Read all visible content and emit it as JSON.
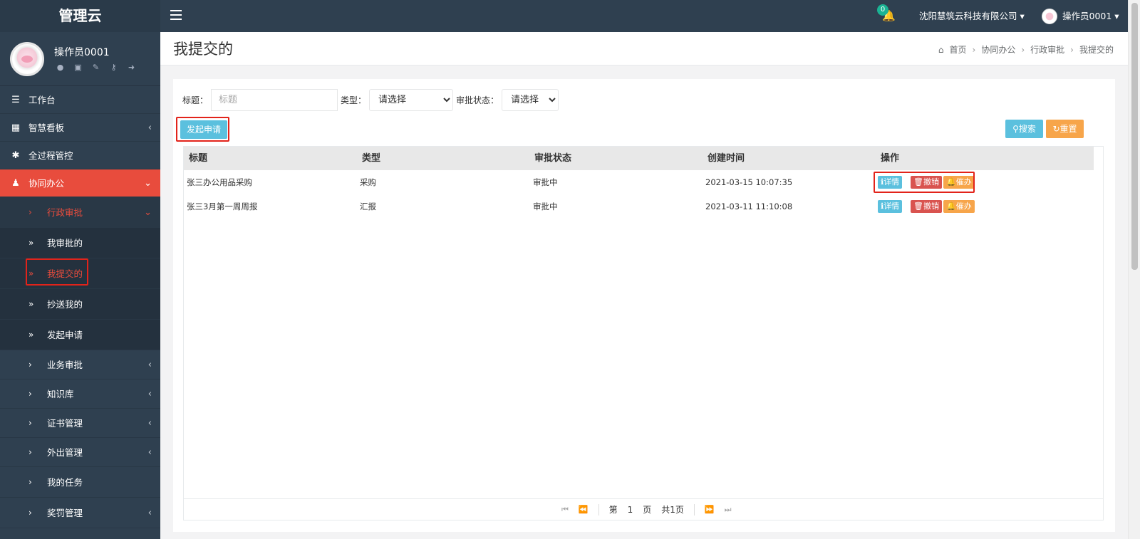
{
  "brand": "管理云",
  "profile": {
    "name": "操作员0001"
  },
  "sidebar": {
    "items": [
      {
        "label": "工作台"
      },
      {
        "label": "智慧看板"
      },
      {
        "label": "全过程管控"
      },
      {
        "label": "协同办公"
      }
    ],
    "admin_group": "行政审批",
    "admin_children": [
      "我审批的",
      "我提交的",
      "抄送我的",
      "发起申请"
    ],
    "other_groups": [
      "业务审批",
      "知识库",
      "证书管理",
      "外出管理",
      "我的任务",
      "奖罚管理"
    ]
  },
  "topbar": {
    "notification_count": "0",
    "company": "沈阳慧筑云科技有限公司",
    "user": "操作员0001"
  },
  "page": {
    "title": "我提交的",
    "breadcrumb": [
      "首页",
      "协同办公",
      "行政审批",
      "我提交的"
    ]
  },
  "filters": {
    "title_label": "标题：",
    "title_placeholder": "标题",
    "type_label": "类型：",
    "type_select": "请选择",
    "status_label": "审批状态：",
    "status_select": "请选择"
  },
  "buttons": {
    "create": "发起申请",
    "search": "搜索",
    "reset": "重置"
  },
  "table": {
    "headers": [
      "标题",
      "类型",
      "审批状态",
      "创建时间",
      "操作"
    ],
    "rows": [
      {
        "title": "张三办公用品采购",
        "type": "采购",
        "status": "审批中",
        "created": "2021-03-15 10:07:35"
      },
      {
        "title": "张三3月第一周周报",
        "type": "汇报",
        "status": "审批中",
        "created": "2021-03-11 11:10:08"
      }
    ],
    "actions": {
      "detail": "详情",
      "revoke": "撤销",
      "urge": "催办"
    }
  },
  "pager": {
    "prefix": "第",
    "page": "1",
    "suffix": "页",
    "total": "共1页"
  },
  "colors": {
    "sidebar": "#2f4050",
    "active": "#e84c3d",
    "info": "#5bc0de",
    "warning": "#f7a54a",
    "danger": "#d9534f",
    "highlight": "#e2231a"
  }
}
